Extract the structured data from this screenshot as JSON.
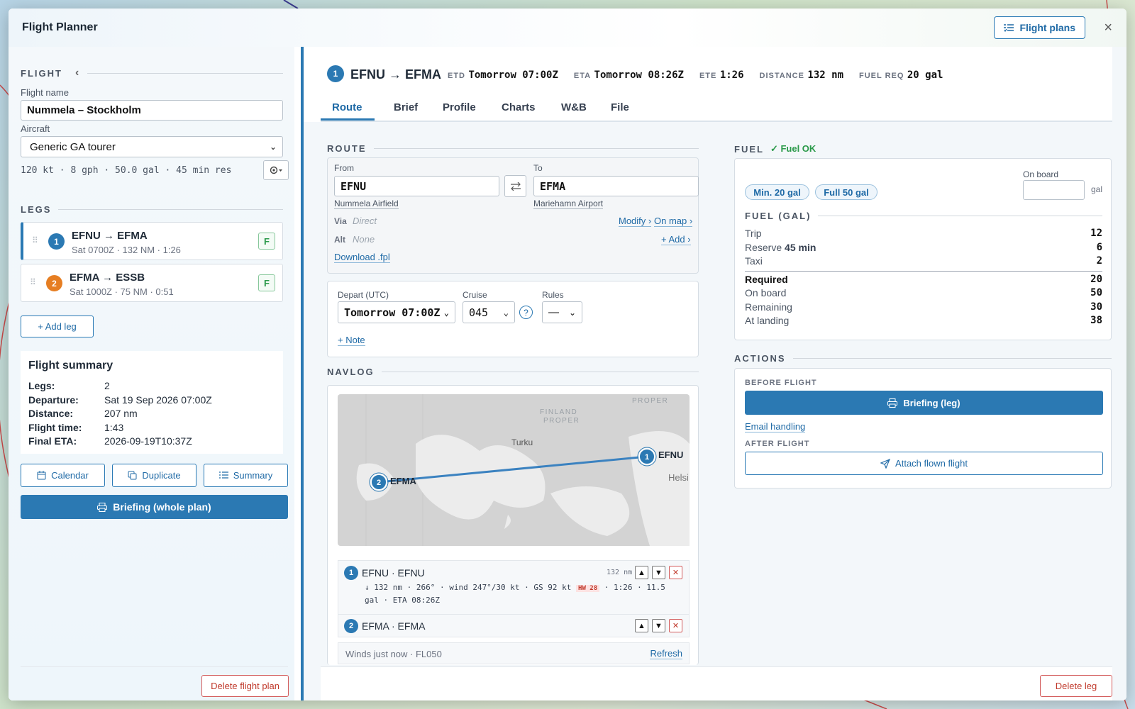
{
  "header": {
    "title": "Flight Planner",
    "flight_plans_label": "Flight plans",
    "close_label": "×"
  },
  "left": {
    "flight_section": "FLIGHT",
    "collapse_label": "‹",
    "flight_name_label": "Flight name",
    "flight_name_value": "Nummela – Stockholm",
    "aircraft_label": "Aircraft",
    "aircraft_value": "Generic GA tourer",
    "aircraft_specs": "120 kt · 8 gph · 50.0 gal · 45 min res",
    "legs_section": "LEGS",
    "legs": [
      {
        "num": "1",
        "title": "EFNU → EFMA",
        "sub": "Sat 0700Z · 132 NM · 1:26",
        "badge": "F",
        "color": "#2b79b3"
      },
      {
        "num": "2",
        "title": "EFMA → ESSB",
        "sub": "Sat 1000Z · 75 NM · 0:51",
        "badge": "F",
        "color": "#e67e22"
      }
    ],
    "add_leg_label": "+ Add leg",
    "summary": {
      "title": "Flight summary",
      "rows": [
        {
          "k": "Legs:",
          "v": "2"
        },
        {
          "k": "Departure:",
          "v": "Sat 19 Sep 2026 07:00Z"
        },
        {
          "k": "Distance:",
          "v": "207 nm"
        },
        {
          "k": "Flight time:",
          "v": "1:43"
        },
        {
          "k": "Final ETA:",
          "v": "2026-09-19T10:37Z"
        }
      ]
    },
    "calendar_label": "Calendar",
    "duplicate_label": "Duplicate",
    "summary_label": "Summary",
    "briefing_plan_label": "Briefing (whole plan)",
    "delete_plan_label": "Delete flight plan"
  },
  "right": {
    "leg_num": "1",
    "leg_title": "EFNU → EFMA",
    "stats": [
      {
        "k": "ETD",
        "v": "Tomorrow 07:00Z"
      },
      {
        "k": "ETA",
        "v": "Tomorrow 08:26Z"
      },
      {
        "k": "ETE",
        "v": "1:26"
      },
      {
        "k": "DISTANCE",
        "v": "132 nm"
      },
      {
        "k": "FUEL REQ",
        "v": "20 gal"
      }
    ],
    "tabs": [
      "Route",
      "Brief",
      "Profile",
      "Charts",
      "W&B",
      "File"
    ],
    "active_tab": "Route",
    "route": {
      "section": "ROUTE",
      "from_label": "From",
      "from_value": "EFNU",
      "from_name": "Nummela Airfield",
      "to_label": "To",
      "to_value": "EFMA",
      "to_name": "Mariehamn Airport",
      "via_label": "Via",
      "via_value": "Direct",
      "modify_label": "Modify ›",
      "on_map_label": "On map ›",
      "alt_label": "Alt",
      "alt_value": "None",
      "add_label": "+ Add ›",
      "download_label": "Download .fpl"
    },
    "depart": {
      "depart_label": "Depart (UTC)",
      "depart_value": "Tomorrow 07:00Z",
      "cruise_label": "Cruise",
      "cruise_value": "045",
      "help_label": "?",
      "rules_label": "Rules",
      "rules_value": "—",
      "note_label": "+ Note"
    },
    "navlog": {
      "section": "NAVLOG",
      "map_labels": {
        "finland_proper_1": "FINLAND",
        "finland_proper_2": "PROPER",
        "turku": "Turku",
        "helsinki": "Helsi",
        "uusimaa_1": "…",
        "top_label": "PROPER"
      },
      "points": [
        {
          "num": "1",
          "name": "EFNU"
        },
        {
          "num": "2",
          "name": "EFMA"
        }
      ],
      "rows": [
        {
          "num": "1",
          "title": "EFNU · EFNU",
          "dist": "132 nm",
          "detail_a": "↓ 132 nm · 266° · wind 247°/30 kt · GS 92 kt",
          "hw": "HW 28",
          "detail_b": "· 1:26 · 11.5",
          "detail_c": "gal · ETA 08:26Z"
        },
        {
          "num": "2",
          "title": "EFMA · EFMA"
        }
      ],
      "winds_label": "Winds just now · FL050",
      "refresh_label": "Refresh"
    },
    "fuel": {
      "section": "FUEL",
      "status": "✓ Fuel OK",
      "min_label": "Min. 20 gal",
      "full_label": "Full 50 gal",
      "on_board_label": "On board",
      "unit": "gal",
      "gal_section": "FUEL (GAL)",
      "rows_top": [
        {
          "k": "Trip",
          "v": "12"
        },
        {
          "k": "Reserve",
          "k2": "45 min",
          "v": "6"
        },
        {
          "k": "Taxi",
          "v": "2"
        }
      ],
      "rows_bottom": [
        {
          "k": "Required",
          "v": "20"
        },
        {
          "k": "On board",
          "v": "50"
        },
        {
          "k": "Remaining",
          "v": "30"
        },
        {
          "k": "At landing",
          "v": "38"
        }
      ]
    },
    "actions": {
      "section": "ACTIONS",
      "before": "BEFORE FLIGHT",
      "briefing_leg": "Briefing (leg)",
      "email": "Email handling",
      "after": "AFTER FLIGHT",
      "attach": "Attach flown flight"
    },
    "delete_leg_label": "Delete leg"
  },
  "colors": {
    "accent": "#2b79b3",
    "leg2": "#e67e22",
    "ok": "#2b9a4a",
    "danger": "#c0392b"
  }
}
